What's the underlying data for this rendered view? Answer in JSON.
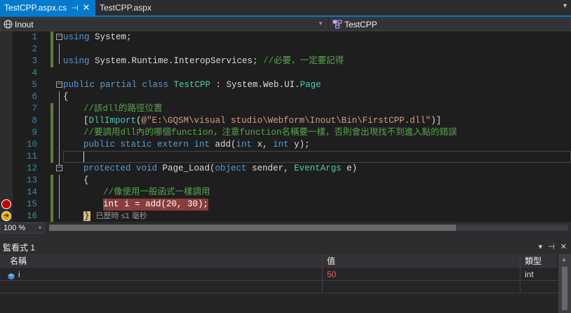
{
  "tabs": [
    {
      "label": "TestCPP.aspx.cs",
      "pin": "⊣",
      "close": "✕"
    },
    {
      "label": "TestCPP.aspx"
    }
  ],
  "tab_dropdown": "▾",
  "navbar": {
    "left_label": "Inout",
    "left_icon": "globe-icon",
    "right_label": "TestCPP",
    "right_icon": "class-icon"
  },
  "editor": {
    "lines": [
      {
        "n": "1"
      },
      {
        "n": "2"
      },
      {
        "n": "3"
      },
      {
        "n": "4"
      },
      {
        "n": "5"
      },
      {
        "n": "6"
      },
      {
        "n": "7"
      },
      {
        "n": "8"
      },
      {
        "n": "9"
      },
      {
        "n": "10"
      },
      {
        "n": "11"
      },
      {
        "n": "12"
      },
      {
        "n": "13"
      },
      {
        "n": "14"
      },
      {
        "n": "15"
      },
      {
        "n": "16"
      }
    ],
    "l1": {
      "kw": "using",
      "rest": " System;"
    },
    "l3": {
      "kw": "using",
      "rest": " System.Runtime.InteropServices; ",
      "comment": "//必要，一定要記得"
    },
    "l5": {
      "kw": "public partial class",
      "ty1": " TestCPP",
      "mid": " : System.Web.UI.",
      "ty2": "Page"
    },
    "l6": {
      "text": "{"
    },
    "l7": {
      "comment": "//該dll的路徑位置"
    },
    "l8": {
      "open": "[",
      "attr": "DllImport",
      "paren": "(",
      "str": "@\"E:\\GQSM\\visual studio\\Webform\\Inout\\Bin\\FirstCPP.dll\"",
      "close": ")]"
    },
    "l9": {
      "comment": "//要調用dll內的哪個function，注意function名稱要一樣，否則會出現找不到進入點的錯誤"
    },
    "l10": {
      "kw1": "public static extern int",
      "name": " add(",
      "kw2": "int",
      "mid": " x, ",
      "kw3": "int",
      "end": " y);"
    },
    "l12": {
      "kw1": "protected void",
      "name": " Page_Load(",
      "kw2": "object",
      "mid": " sender, ",
      "ty": "EventArgs",
      "end": " e)"
    },
    "l13": {
      "text": "{"
    },
    "l14": {
      "comment": "//像使用一般函式一樣調用"
    },
    "l15": {
      "kw": "int",
      "rest": " i = add(20, 30);"
    },
    "l16": {
      "brace": "}",
      "tip": "已歷時 ≤1 毫秒"
    }
  },
  "zoom": {
    "value": "100 %",
    "arrow": "▾"
  },
  "watch": {
    "title": "監看式 1",
    "buttons": [
      "▾",
      "⊣",
      "✕"
    ],
    "columns": {
      "name": "名稱",
      "value": "值",
      "type": "類型"
    },
    "rows": [
      {
        "name": "i",
        "value": "50",
        "type": "int",
        "icon": "variable-icon"
      }
    ]
  },
  "colors": {
    "accent": "#007acc",
    "keyword": "#569cd6",
    "type": "#4ec9b0",
    "comment": "#57a64a",
    "string": "#d69d85",
    "breakpoint": "#c50000",
    "changed_value": "#ff5c5c"
  }
}
